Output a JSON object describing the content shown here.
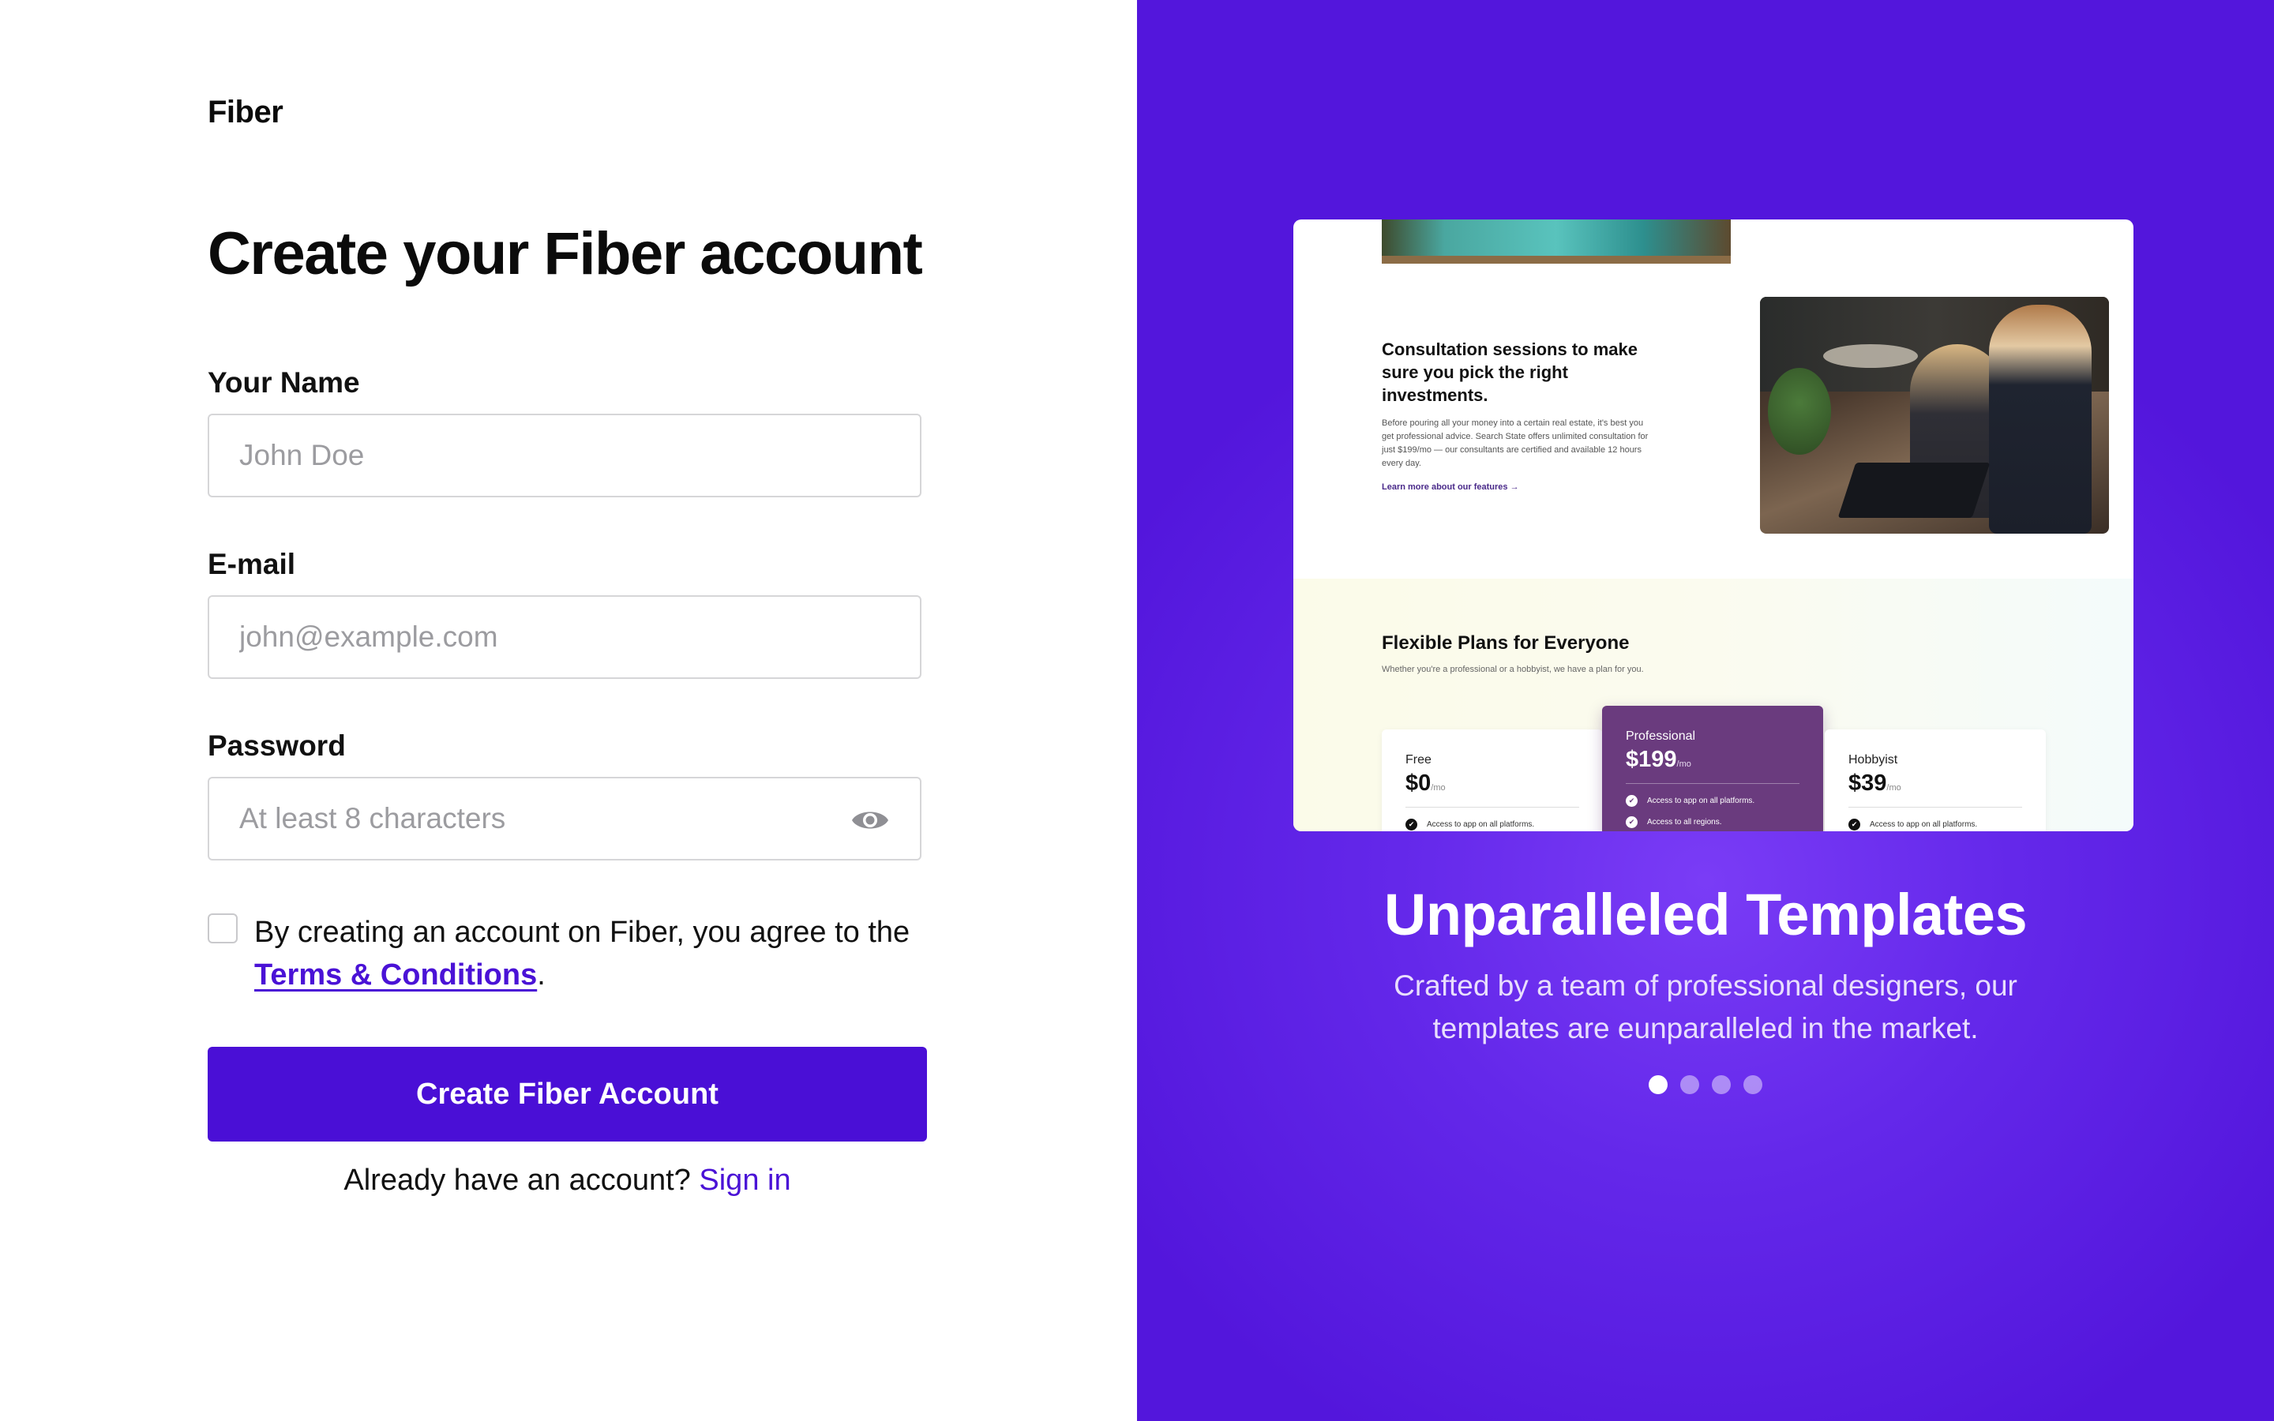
{
  "brand": "Fiber",
  "page_title": "Create your Fiber account",
  "form": {
    "name_label": "Your Name",
    "name_placeholder": "John Doe",
    "email_label": "E-mail",
    "email_placeholder": "john@example.com",
    "password_label": "Password",
    "password_placeholder": "At least 8 characters",
    "consent_text": "By creating an account on Fiber, you agree to the",
    "terms_link": "Terms & Conditions",
    "consent_end": ".",
    "submit_label": "Create Fiber Account",
    "signin_prompt": "Already have an account?",
    "signin_link": "Sign in"
  },
  "showcase": {
    "preview": {
      "section_heading": "Consultation sessions to make sure you pick the right investments.",
      "section_body": "Before pouring all your money into a certain real estate, it's best you get professional advice. Search State offers unlimited consultation for just $199/mo — our consultants are certified and available 12 hours every day.",
      "section_link": "Learn more about our features →",
      "plans_title": "Flexible Plans for Everyone",
      "plans_subtitle": "Whether you're a professional or a hobbyist, we have a plan for you.",
      "plans": [
        {
          "name": "Free",
          "price": "$0",
          "period": "/mo",
          "features": [
            "Access to app on all platforms."
          ]
        },
        {
          "name": "Professional",
          "price": "$199",
          "period": "/mo",
          "features": [
            "Access to app on all platforms.",
            "Access to all regions."
          ]
        },
        {
          "name": "Hobbyist",
          "price": "$39",
          "period": "/mo",
          "features": [
            "Access to app on all platforms."
          ]
        }
      ]
    },
    "title": "Unparalleled Templates",
    "description": "Crafted by a team of professional designers, our templates are eunparalleled in the market.",
    "carousel": {
      "total": 4,
      "active_index": 0
    }
  },
  "colors": {
    "accent": "#4a0fd6",
    "panel": "#5316dc",
    "link": "#4a12d6"
  },
  "icons": {
    "password_toggle": "eye-icon",
    "feature_check": "check-circle-icon"
  }
}
